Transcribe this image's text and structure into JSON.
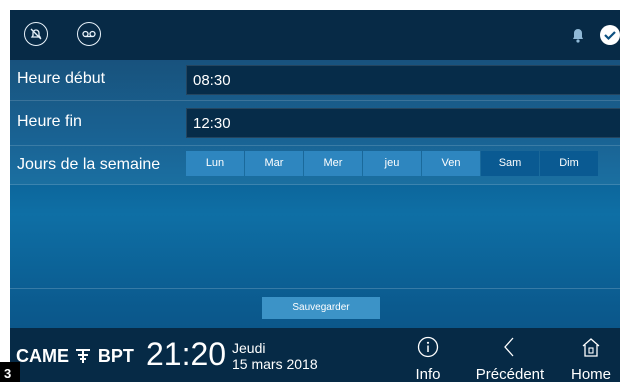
{
  "topbar": {
    "icons": [
      "mute-bell-icon",
      "voicemail-icon",
      "bell-icon",
      "check-icon"
    ]
  },
  "form": {
    "start_label": "Heure début",
    "start_value": "08:30",
    "end_label": "Heure fin",
    "end_value": "12:30",
    "days_label": "Jours de la semaine",
    "days": [
      {
        "label": "Lun",
        "selected": true
      },
      {
        "label": "Mar",
        "selected": true
      },
      {
        "label": "Mer",
        "selected": true
      },
      {
        "label": "jeu",
        "selected": true
      },
      {
        "label": "Ven",
        "selected": true
      },
      {
        "label": "Sam",
        "selected": false
      },
      {
        "label": "Dim",
        "selected": false
      }
    ],
    "save_label": "Sauvegarder"
  },
  "footer": {
    "brand_came": "CAME",
    "brand_bpt": "BPT",
    "time": "21:20",
    "day": "Jeudi",
    "date": "15 mars 2018",
    "nav": [
      {
        "label": "Info",
        "icon": "info-icon"
      },
      {
        "label": "Précédent",
        "icon": "chevron-left-icon"
      },
      {
        "label": "Home",
        "icon": "home-icon"
      }
    ]
  },
  "page_badge": "3",
  "colors": {
    "accent": "#2e86bf",
    "background": "#0b5a8e",
    "bar": "#062a46"
  }
}
